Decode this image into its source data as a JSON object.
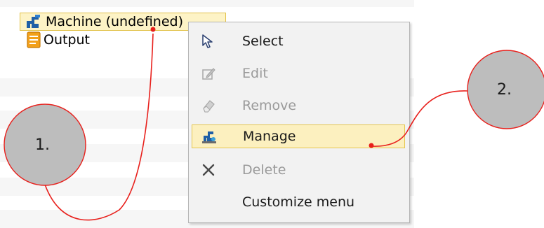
{
  "tree": {
    "items": [
      {
        "label": "Machine (undefined)",
        "icon": "machine-icon",
        "selected": true
      },
      {
        "label": "Output",
        "icon": "output-document-icon",
        "selected": false
      }
    ]
  },
  "context_menu": {
    "items": [
      {
        "label": "Select",
        "icon": "cursor-arrow-icon",
        "enabled": true,
        "highlighted": false
      },
      {
        "label": "Edit",
        "icon": "edit-icon",
        "enabled": false,
        "highlighted": false
      },
      {
        "label": "Remove",
        "icon": "eraser-icon",
        "enabled": false,
        "highlighted": false
      },
      {
        "label": "Manage",
        "icon": "machine-manage-icon",
        "enabled": true,
        "highlighted": true
      },
      {
        "label": "Delete",
        "icon": "delete-x-icon",
        "enabled": false,
        "highlighted": false
      },
      {
        "label": "Customize menu",
        "icon": "",
        "enabled": true,
        "highlighted": false
      }
    ]
  },
  "annotations": {
    "step1": "1.",
    "step2": "2."
  },
  "colors": {
    "selection_fill": "#fdf3c6",
    "selection_border": "#e2c24a",
    "callout_line": "#e8201c",
    "badge_fill": "#bdbdbd"
  }
}
